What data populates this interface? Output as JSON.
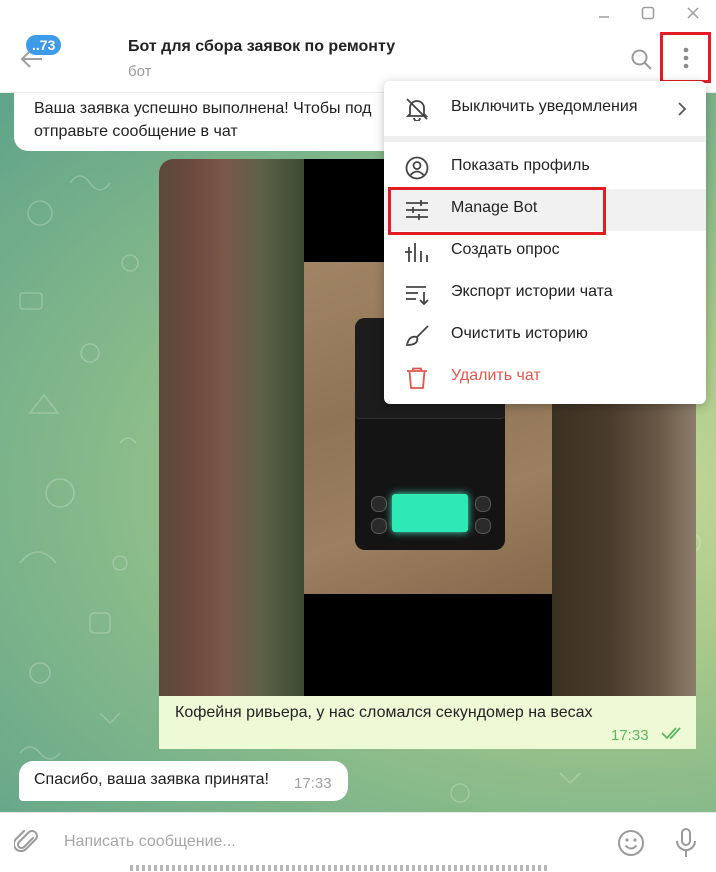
{
  "window": {
    "controls": [
      "minimize-icon",
      "maximize-icon",
      "close-icon"
    ]
  },
  "header": {
    "unread_badge": "..73",
    "title": "Бот для сбора заявок по ремонту",
    "subtitle": "бот",
    "icons": [
      "back-arrow-icon",
      "search-icon",
      "more-vertical-icon"
    ]
  },
  "messages": {
    "top_text": "Ваша заявка успешно выполнена! Чтобы под",
    "top_text_line2": "отправьте сообщение в чат",
    "photo_caption": "Кофейня ривьера, у нас сломался секундомер на весах",
    "photo_time": "17:33",
    "reply_text": "Спасибо, ваша заявка принята!",
    "reply_time": "17:33"
  },
  "menu": {
    "items": [
      {
        "label": "Выключить уведомления",
        "icon": "mute-bell-icon"
      },
      {
        "label": "Показать профиль",
        "icon": "profile-icon"
      },
      {
        "label": "Manage Bot",
        "icon": "sliders-icon"
      },
      {
        "label": "Создать опрос",
        "icon": "poll-icon"
      },
      {
        "label": "Экспорт истории чата",
        "icon": "export-icon"
      },
      {
        "label": "Очистить историю",
        "icon": "broom-icon"
      },
      {
        "label": "Удалить чат",
        "icon": "trash-icon"
      }
    ],
    "colors": {
      "danger": "#e2574c",
      "highlight_border": "#e11e26"
    }
  },
  "input": {
    "placeholder": "Написать сообщение...",
    "icons": [
      "paperclip-icon",
      "emoji-icon",
      "microphone-icon"
    ]
  },
  "colors": {
    "accent": "#3d9be9",
    "outgoing_bubble": "#eefad6",
    "read_check": "#5fb55e"
  }
}
